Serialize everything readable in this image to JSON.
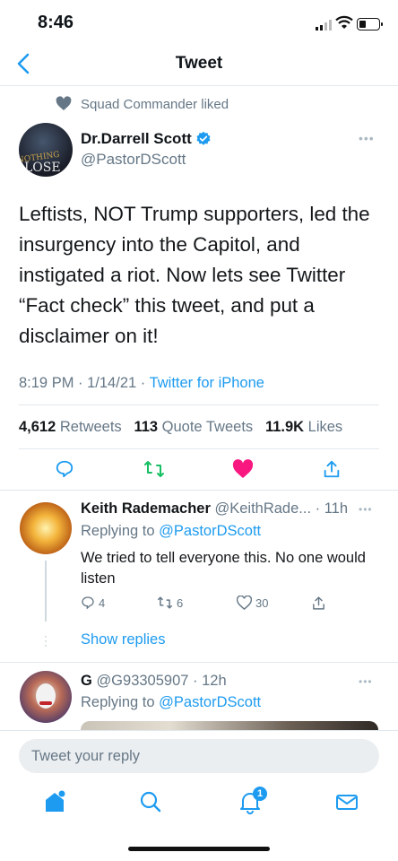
{
  "status_bar": {
    "time": "8:46"
  },
  "nav": {
    "title": "Tweet"
  },
  "social_context": {
    "text": "Squad Commander liked"
  },
  "tweet": {
    "author_name": "Dr.Darrell Scott",
    "author_handle": "@PastorDScott",
    "avatar_text": [
      "NOTHING",
      "LOSE"
    ],
    "text": "Leftists, NOT Trump supporters,  led the insurgency into the Capitol, and instigated a riot. Now lets see Twitter “Fact check” this tweet, and put a disclaimer on it!",
    "time": "8:19 PM",
    "date": "1/14/21",
    "source": "Twitter for iPhone",
    "retweets_count": "4,612",
    "retweets_label": "Retweets",
    "quotes_count": "113",
    "quotes_label": "Quote Tweets",
    "likes_count": "11.9K",
    "likes_label": "Likes",
    "liked": true
  },
  "replies": [
    {
      "name": "Keith Rademacher",
      "handle": "@KeithRade...",
      "age": "11h",
      "replying_to_prefix": "Replying to",
      "replying_to": "@PastorDScott",
      "text": "We tried to tell everyone this. No one would listen",
      "reply_count": "4",
      "retweet_count": "6",
      "like_count": "30",
      "show_replies": "Show replies"
    },
    {
      "name": "G",
      "handle": "@G93305907",
      "age": "12h",
      "replying_to_prefix": "Replying to",
      "replying_to": "@PastorDScott"
    }
  ],
  "compose": {
    "placeholder": "Tweet your reply"
  },
  "tab_bar": {
    "notifications_badge": "1"
  },
  "colors": {
    "accent": "#1d9bf0",
    "like": "#f91880",
    "retweet": "#17bf63",
    "muted": "#657786"
  },
  "icons": [
    "chevron-left-icon",
    "heart-icon",
    "verified-icon",
    "reply-icon",
    "retweet-icon",
    "share-icon",
    "home-icon",
    "search-icon",
    "bell-icon",
    "mail-icon"
  ]
}
